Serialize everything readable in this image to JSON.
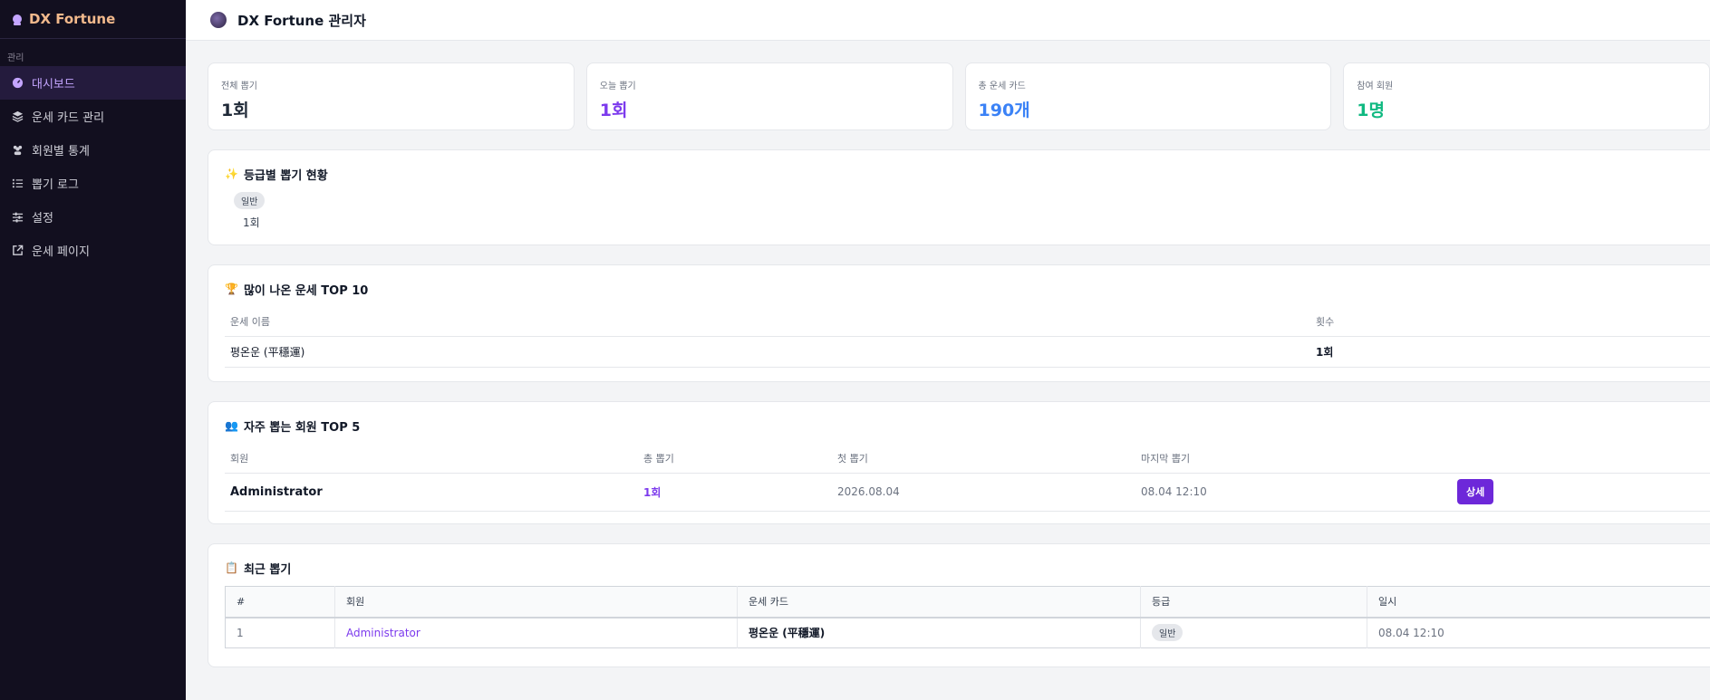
{
  "sidebar": {
    "brand": "DX Fortune",
    "section": "관리",
    "items": [
      {
        "label": "대시보드",
        "icon": "dashboard-icon",
        "active": true
      },
      {
        "label": "운세 카드 관리",
        "icon": "layers-icon",
        "active": false
      },
      {
        "label": "회원별 통계",
        "icon": "users-icon",
        "active": false
      },
      {
        "label": "뽑기 로그",
        "icon": "list-icon",
        "active": false
      },
      {
        "label": "설정",
        "icon": "sliders-icon",
        "active": false
      },
      {
        "label": "운세 페이지",
        "icon": "external-link-icon",
        "active": false
      }
    ]
  },
  "header": {
    "title": "DX Fortune 관리자"
  },
  "stats": [
    {
      "label": "전체 뽑기",
      "value": "1회",
      "color": "#1f2937"
    },
    {
      "label": "오늘 뽑기",
      "value": "1회",
      "color": "#7c3aed"
    },
    {
      "label": "총 운세 카드",
      "value": "190개",
      "color": "#3b82f6"
    },
    {
      "label": "참여 회원",
      "value": "1명",
      "color": "#10b981"
    }
  ],
  "grade_section": {
    "emoji": "✨",
    "title": "등급별 뽑기 현황",
    "badge": "일반",
    "count": "1회"
  },
  "top10": {
    "emoji": "🏆",
    "title": "많이 나온 운세 TOP 10",
    "headers": [
      "운세 이름",
      "횟수"
    ],
    "rows": [
      {
        "name": "평온운 (平穩運)",
        "count": "1회"
      }
    ]
  },
  "top5": {
    "emoji": "👥",
    "title": "자주 뽑는 회원 TOP 5",
    "headers": [
      "회원",
      "총 뽑기",
      "첫 뽑기",
      "마지막 뽑기"
    ],
    "rows": [
      {
        "member": "Administrator",
        "total": "1회",
        "first": "2026.08.04",
        "last": "08.04 12:10",
        "button": "상세"
      }
    ]
  },
  "recent": {
    "emoji": "📋",
    "title": "최근 뽑기",
    "headers": [
      "#",
      "회원",
      "운세 카드",
      "등급",
      "일시"
    ],
    "rows": [
      {
        "num": "1",
        "member": "Administrator",
        "card": "평온운 (平穩運)",
        "grade": "일반",
        "time": "08.04 12:10"
      }
    ]
  }
}
